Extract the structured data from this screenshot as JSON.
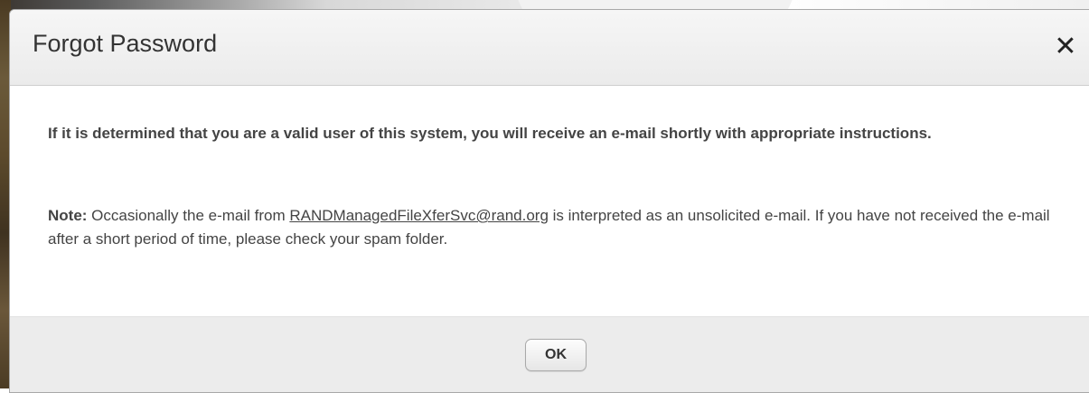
{
  "dialog": {
    "title": "Forgot Password",
    "close_glyph": "✕",
    "close_icon": "close-icon"
  },
  "body": {
    "primary_message": "If it is determined that you are a valid user of this system, you will receive an e-mail shortly with appropriate instructions.",
    "note_label": "Note:",
    "note_prefix": " Occasionally the e-mail from ",
    "note_email": "RANDManagedFileXferSvc@rand.org",
    "note_suffix": " is interpreted as an unsolicited e-mail. If you have not received the e-mail after a short period of time, please check your spam folder."
  },
  "footer": {
    "ok_label": "OK"
  }
}
